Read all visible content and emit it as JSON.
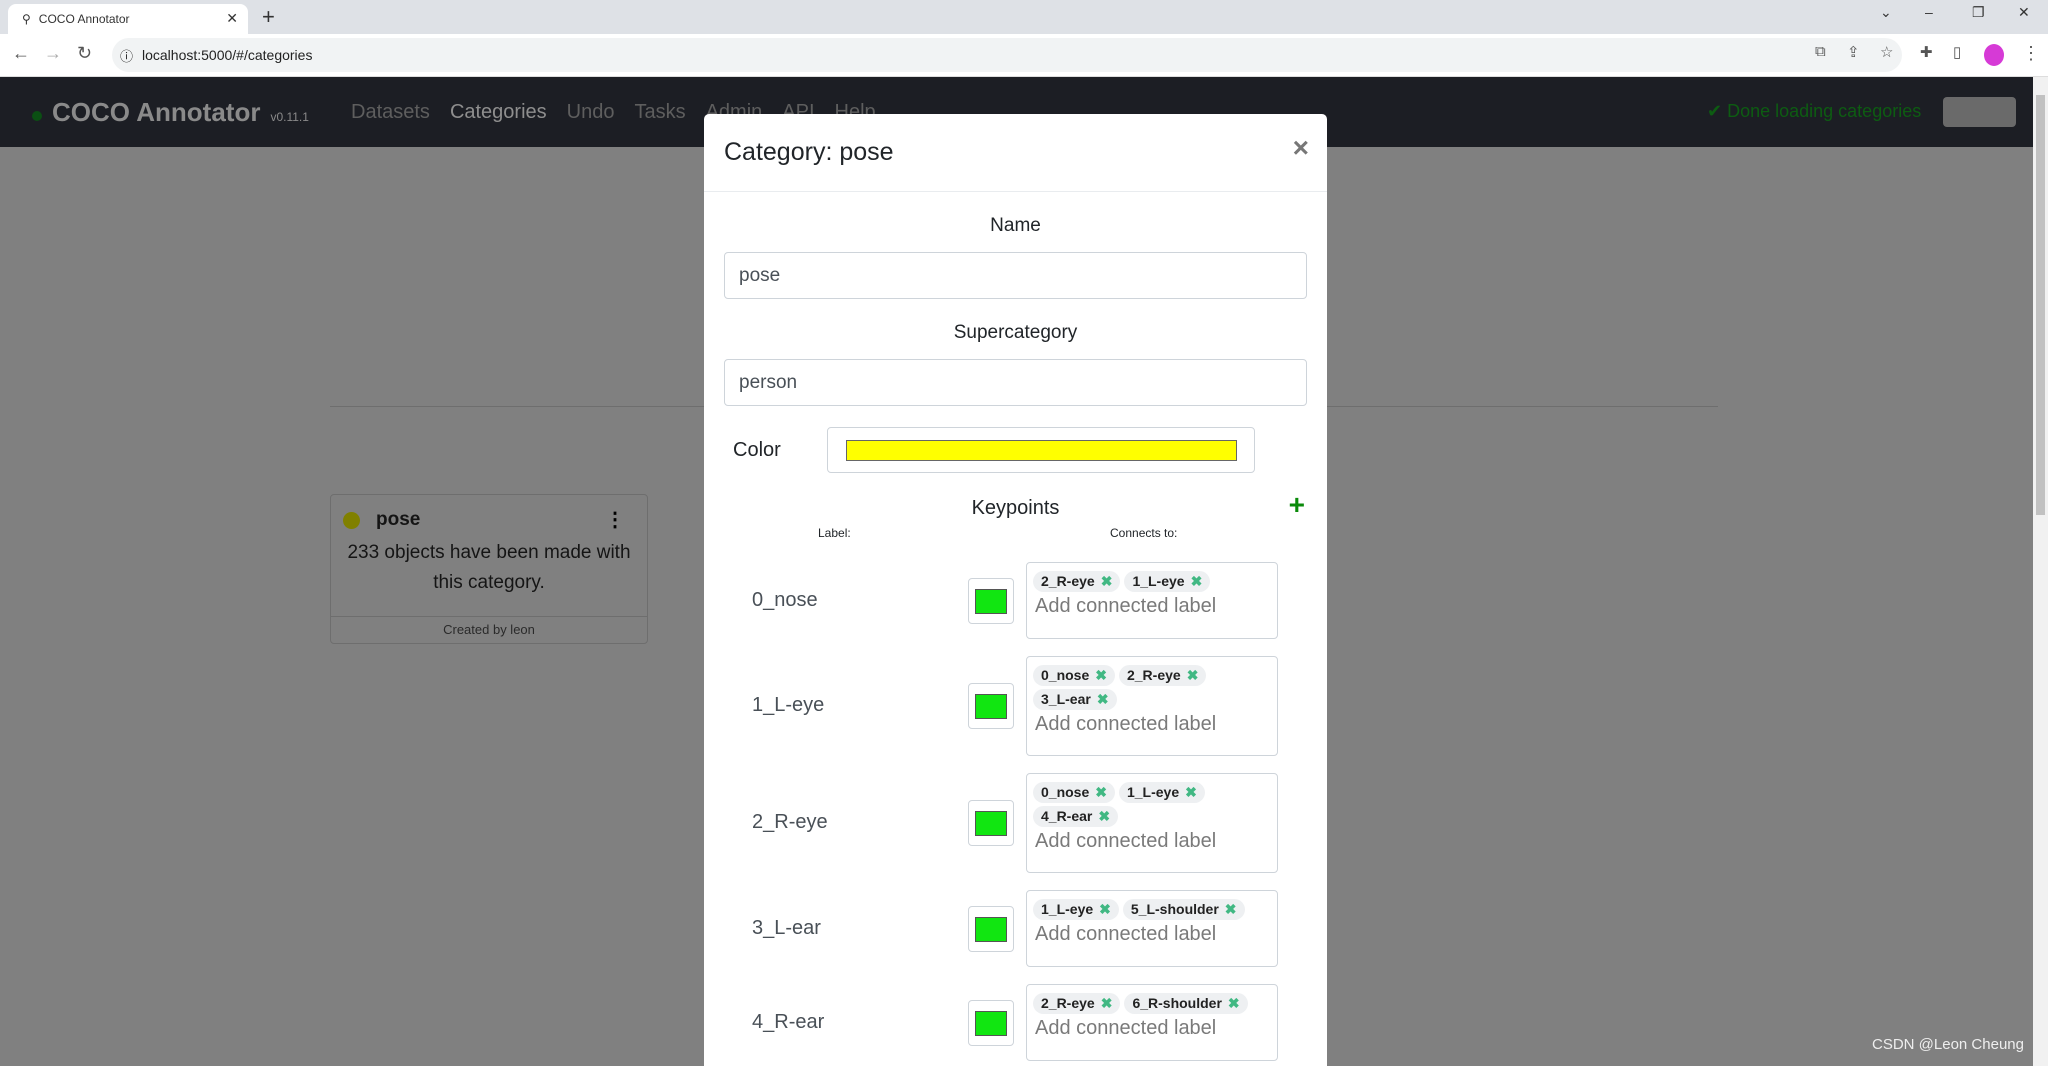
{
  "browser": {
    "tab_title": "COCO Annotator",
    "url": "localhost:5000/#/categories"
  },
  "navbar": {
    "brand": "COCO Annotator",
    "version": "v0.11.1",
    "menu": [
      "Datasets",
      "Categories",
      "Undo",
      "Tasks",
      "Admin",
      "API",
      "Help"
    ],
    "active": "Categories",
    "status": "✔ Done loading categories"
  },
  "card": {
    "name": "pose",
    "color": "#ffff00",
    "body": "233 objects have been made with this category.",
    "footer": "Created by leon"
  },
  "modal": {
    "title": "Category: pose",
    "name_label": "Name",
    "name_value": "pose",
    "supercategory_label": "Supercategory",
    "supercategory_value": "person",
    "color_label": "Color",
    "color_value": "#ffff00",
    "keypoints_title": "Keypoints",
    "label_header": "Label:",
    "connects_header": "Connects to:",
    "placeholder": "Add connected label",
    "keypoints": [
      {
        "label": "0_nose",
        "color": "#11e611",
        "connects": [
          "2_R-eye",
          "1_L-eye"
        ]
      },
      {
        "label": "1_L-eye",
        "color": "#11e611",
        "connects": [
          "0_nose",
          "2_R-eye",
          "3_L-ear"
        ]
      },
      {
        "label": "2_R-eye",
        "color": "#11e611",
        "connects": [
          "0_nose",
          "1_L-eye",
          "4_R-ear"
        ]
      },
      {
        "label": "3_L-ear",
        "color": "#11e611",
        "connects": [
          "1_L-eye",
          "5_L-shoulder"
        ]
      },
      {
        "label": "4_R-ear",
        "color": "#11e611",
        "connects": [
          "2_R-eye",
          "6_R-shoulder"
        ]
      }
    ]
  },
  "watermark": "CSDN @Leon Cheung"
}
